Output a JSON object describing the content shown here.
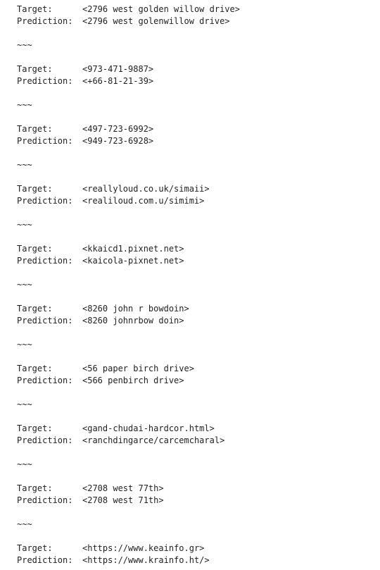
{
  "labels": {
    "target": "Target:",
    "prediction": "Prediction:",
    "separator": "~~~"
  },
  "entries": [
    {
      "target": "<2796 west golden willow drive>",
      "prediction": "<2796 west golenwillow drive>"
    },
    {
      "target": "<973-471-9887>",
      "prediction": "<+66-81-21-39>"
    },
    {
      "target": "<497-723-6992>",
      "prediction": "<949-723-6928>"
    },
    {
      "target": "<reallyloud.co.uk/simaii>",
      "prediction": "<realiloud.com.u/simimi>"
    },
    {
      "target": "<kkaicd1.pixnet.net>",
      "prediction": "<kaicola-pixnet.net>"
    },
    {
      "target": "<8260 john r bowdoin>",
      "prediction": "<8260 johnrbow doin>"
    },
    {
      "target": "<56 paper birch drive>",
      "prediction": "<566 penbirch drive>"
    },
    {
      "target": "<gand-chudai-hardcor.html>",
      "prediction": "<ranchdingarce/carcemcharal>"
    },
    {
      "target": "<2708 west 77th>",
      "prediction": "<2708 west 71th>"
    },
    {
      "target": "<https://www.keainfo.gr>",
      "prediction": "<https://www.krainfo.ht/>"
    }
  ]
}
